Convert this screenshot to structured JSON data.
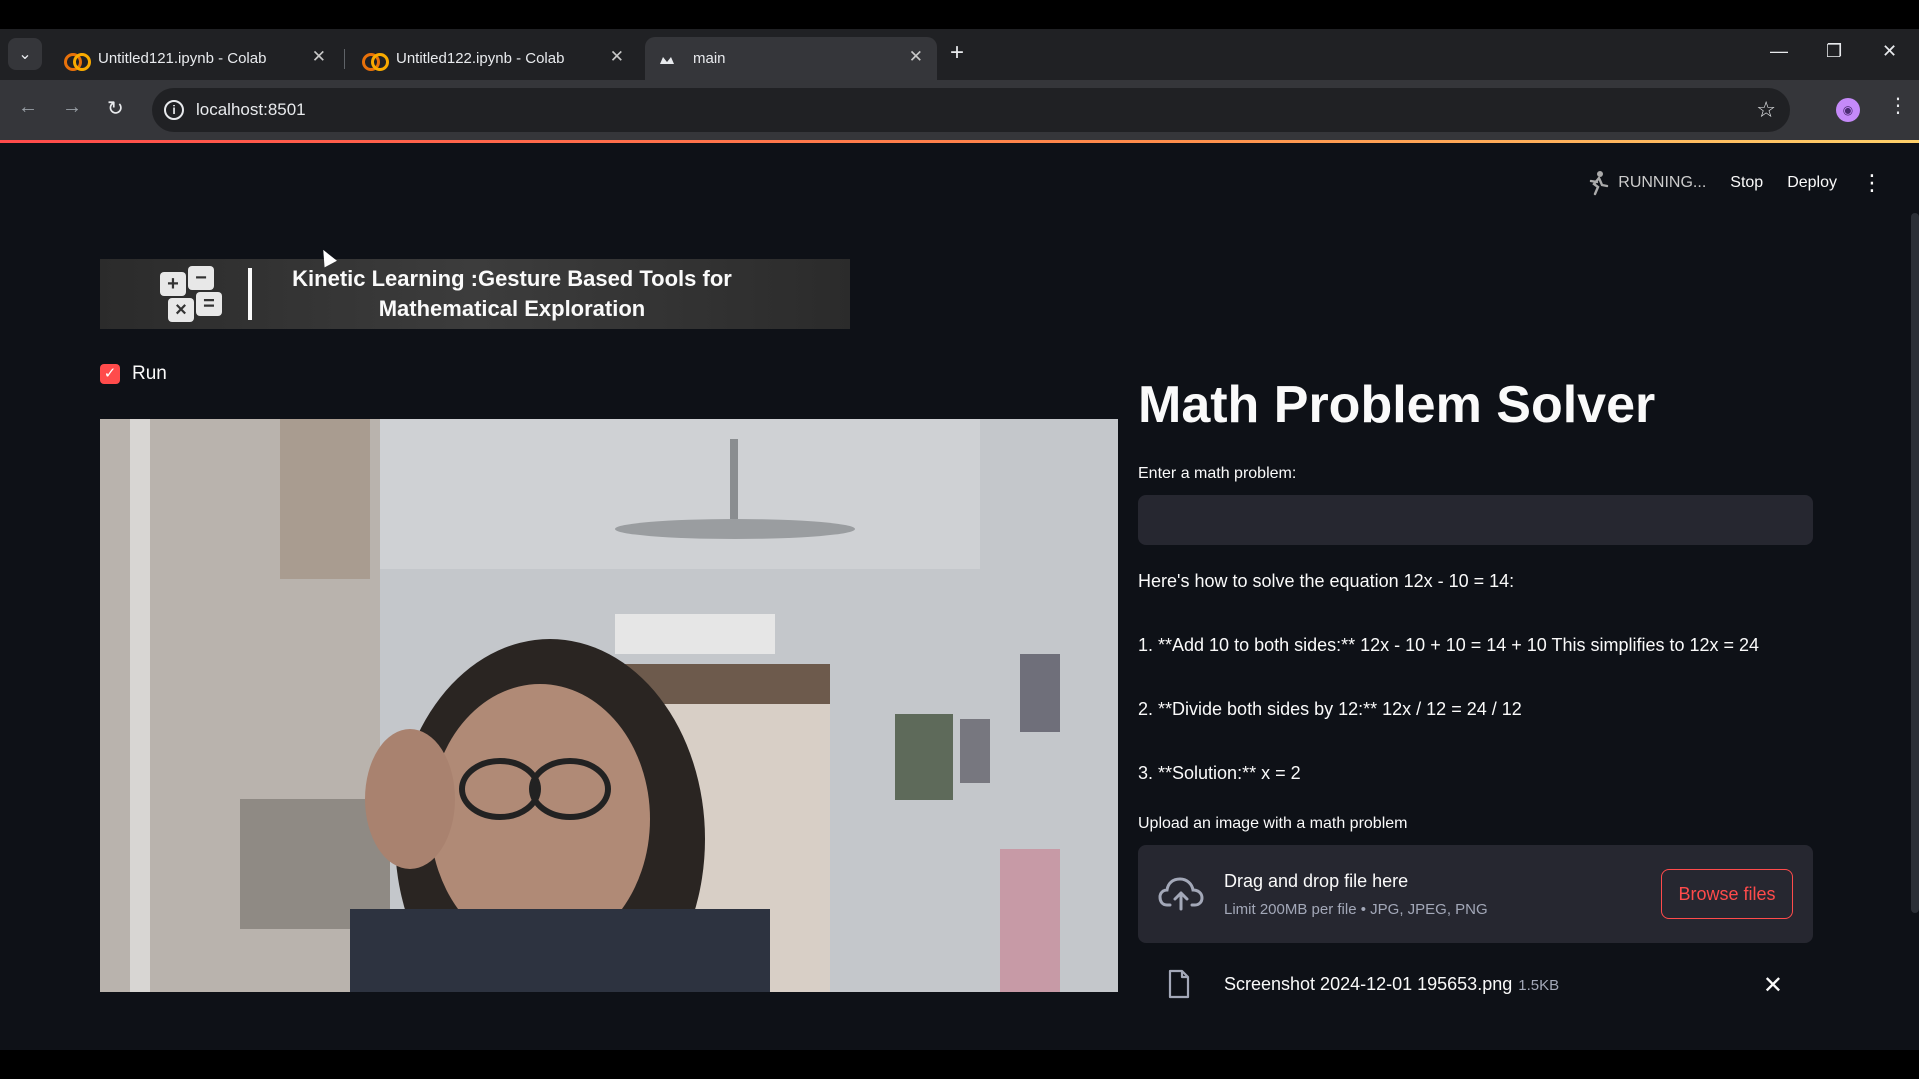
{
  "browser": {
    "tabs": [
      {
        "label": "Untitled121.ipynb - Colab",
        "icon": "colab-icon"
      },
      {
        "label": "Untitled122.ipynb - Colab",
        "icon": "colab-icon"
      },
      {
        "label": "main",
        "icon": "streamlit-icon"
      }
    ],
    "url": "localhost:8501",
    "colors": {
      "accent": "#ff4b4b",
      "chrome": "#202124",
      "toolbar": "#35363a"
    }
  },
  "app_header": {
    "status": "RUNNING...",
    "stop_label": "Stop",
    "deploy_label": "Deploy"
  },
  "banner": {
    "line1": "Kinetic Learning :Gesture Based Tools for",
    "line2": "Mathematical Exploration"
  },
  "run_checkbox": {
    "label": "Run",
    "checked": true
  },
  "solver": {
    "title": "Math Problem Solver",
    "input_label": "Enter a math problem:",
    "input_value": "",
    "answer": [
      "Here's how to solve the equation 12x - 10 = 14:",
      "1. **Add 10 to both sides:** 12x - 10 + 10 = 14 + 10 This simplifies to 12x = 24",
      "2. **Divide both sides by 12:** 12x / 12 = 24 / 12",
      "3. **Solution:** x = 2"
    ],
    "upload_label": "Upload an image with a math problem",
    "dropzone_title": "Drag and drop file here",
    "dropzone_limit": "Limit 200MB per file • JPG, JPEG, PNG",
    "browse_label": "Browse files",
    "uploaded_file": {
      "name": "Screenshot 2024-12-01 195653.png",
      "size": "1.5KB"
    }
  }
}
